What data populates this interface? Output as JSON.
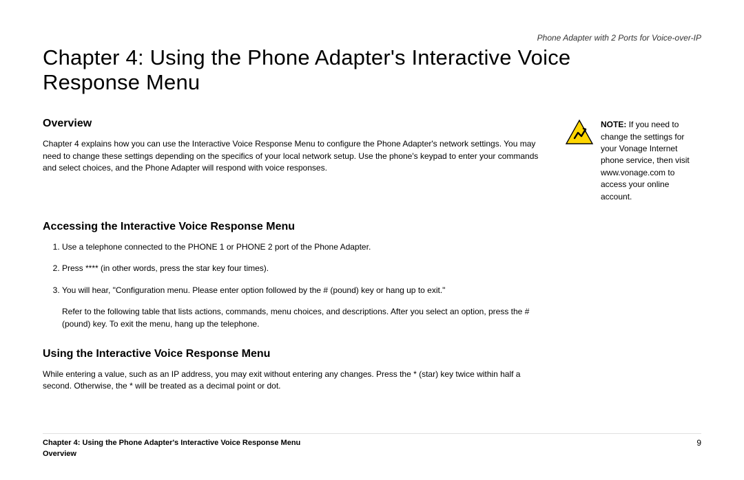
{
  "header": {
    "productLine": "Phone Adapter with 2 Ports for Voice-over-IP"
  },
  "chapter": {
    "title": "Chapter 4: Using the Phone Adapter's Interactive Voice Response Menu"
  },
  "sections": {
    "overview": {
      "heading": "Overview",
      "paragraph": "Chapter 4 explains how you can use the Interactive Voice Response Menu to configure the Phone Adapter's network settings. You may need to change these settings depending on the specifics of your local network setup. Use the phone's keypad to enter your commands and select choices, and the Phone Adapter will respond with voice responses."
    },
    "accessing": {
      "heading": "Accessing the Interactive Voice Response Menu",
      "steps": {
        "s1": "Use a telephone connected to the PHONE 1 or PHONE 2 port of the Phone Adapter.",
        "s2": "Press **** (in other words, press the star key four times).",
        "s3": "You will hear, \"Configuration menu. Please enter option followed by the # (pound) key or hang up to exit.\"",
        "s3b": "Refer to the following table that lists actions, commands, menu choices, and descriptions. After you select an option, press the # (pound) key. To exit the menu, hang up the telephone."
      }
    },
    "using": {
      "heading": "Using the Interactive Voice Response Menu",
      "paragraph": "While entering a value, such as an IP address, you may exit without entering any changes. Press the * (star) key twice within half a second. Otherwise, the * will be treated as a decimal point or dot."
    }
  },
  "note": {
    "label": "NOTE:",
    "text": "If you need to change the settings for your Vonage Internet phone service, then visit www.vonage.com to access your online account."
  },
  "footer": {
    "chapterLine": "Chapter 4: Using the Phone Adapter's Interactive Voice Response Menu",
    "sectionLine": "Overview",
    "pageNumber": "9"
  }
}
